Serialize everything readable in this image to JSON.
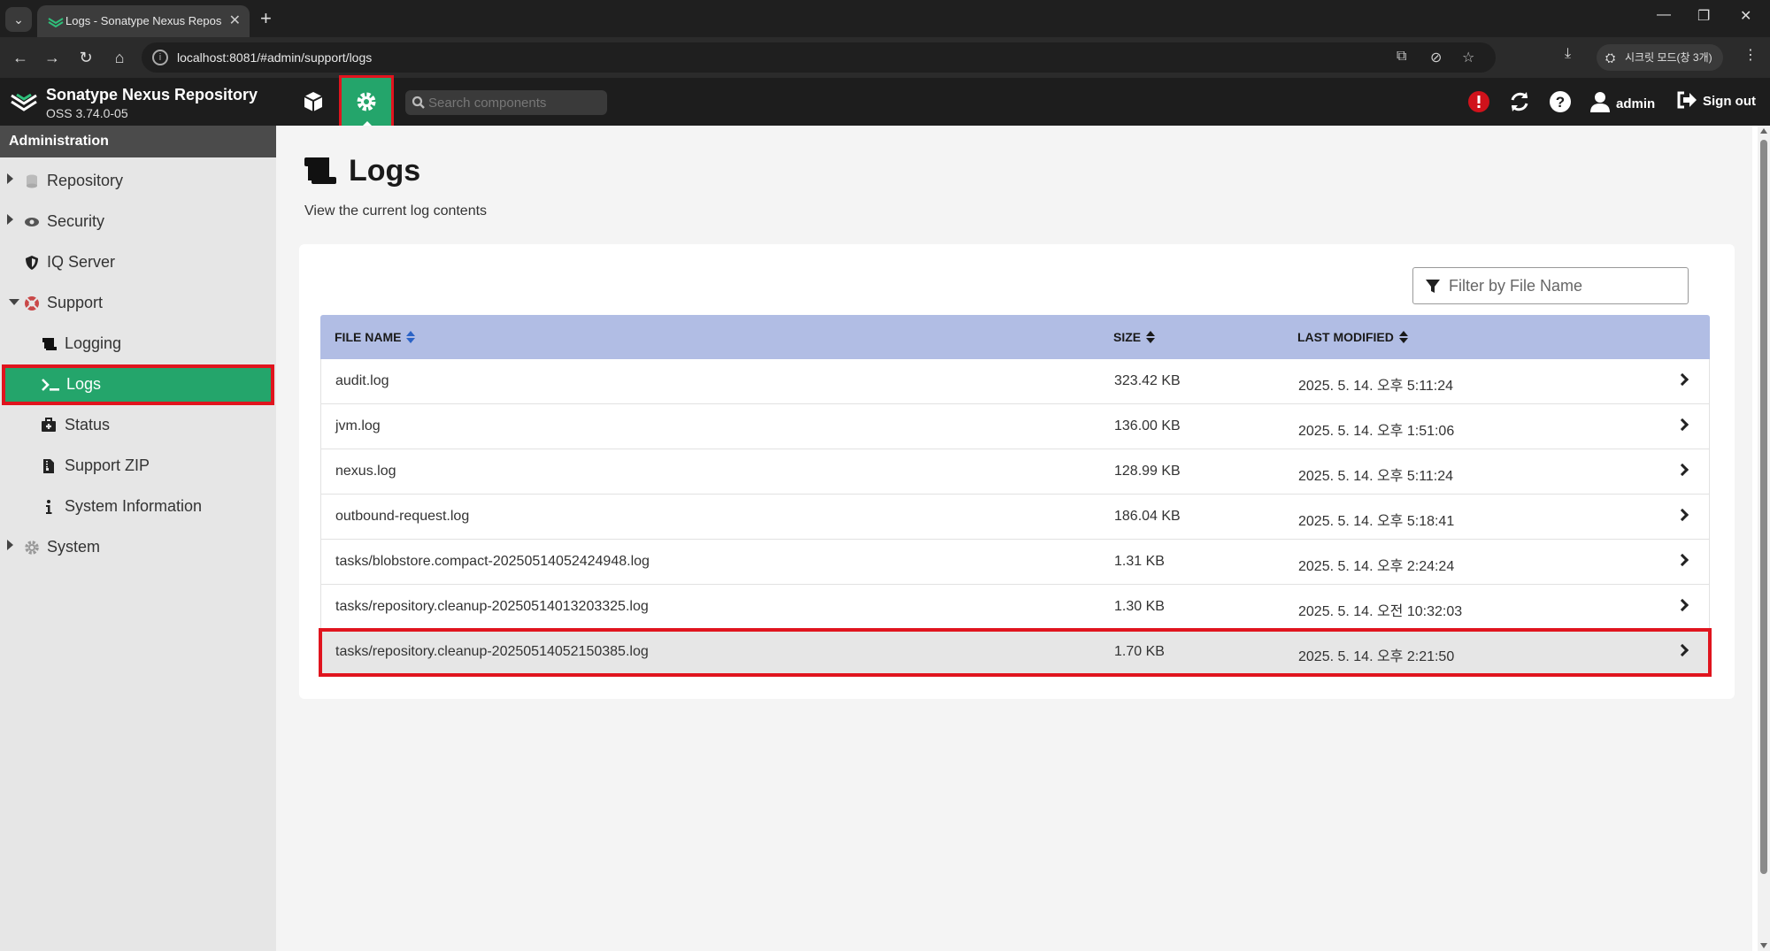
{
  "browser": {
    "tab_title": "Logs - Sonatype Nexus Repos",
    "url": "localhost:8081/#admin/support/logs",
    "incognito_label": "시크릿 모드(창 3개)"
  },
  "header": {
    "app_title": "Sonatype Nexus Repository",
    "version": "OSS 3.74.0-05",
    "search_placeholder": "Search components",
    "user": "admin",
    "signout": "Sign out",
    "accent_color": "#24a56b"
  },
  "sidebar": {
    "heading": "Administration",
    "items": [
      {
        "label": "Repository",
        "icon": "database-icon",
        "expandable": true,
        "expanded": false
      },
      {
        "label": "Security",
        "icon": "eye-icon",
        "expandable": true,
        "expanded": false
      },
      {
        "label": "IQ Server",
        "icon": "shield-icon",
        "expandable": false
      },
      {
        "label": "Support",
        "icon": "lifebuoy-icon",
        "expandable": true,
        "expanded": true
      },
      {
        "label": "Logging",
        "icon": "scroll-icon",
        "child": true
      },
      {
        "label": "Logs",
        "icon": "terminal-icon",
        "child": true,
        "active": true
      },
      {
        "label": "Status",
        "icon": "medkit-icon",
        "child": true
      },
      {
        "label": "Support ZIP",
        "icon": "file-zip-icon",
        "child": true
      },
      {
        "label": "System Information",
        "icon": "info-icon",
        "child": true
      },
      {
        "label": "System",
        "icon": "gear-icon",
        "expandable": true,
        "expanded": false
      }
    ]
  },
  "main": {
    "title": "Logs",
    "subtitle": "View the current log contents",
    "filter_placeholder": "Filter by File Name",
    "columns": [
      "FILE NAME",
      "SIZE",
      "LAST MODIFIED"
    ],
    "rows": [
      {
        "name": "audit.log",
        "size": "323.42 KB",
        "modified": "2025. 5. 14. 오후 5:11:24"
      },
      {
        "name": "jvm.log",
        "size": "136.00 KB",
        "modified": "2025. 5. 14. 오후 1:51:06"
      },
      {
        "name": "nexus.log",
        "size": "128.99 KB",
        "modified": "2025. 5. 14. 오후 5:11:24"
      },
      {
        "name": "outbound-request.log",
        "size": "186.04 KB",
        "modified": "2025. 5. 14. 오후 5:18:41"
      },
      {
        "name": "tasks/blobstore.compact-20250514052424948.log",
        "size": "1.31 KB",
        "modified": "2025. 5. 14. 오후 2:24:24"
      },
      {
        "name": "tasks/repository.cleanup-20250514013203325.log",
        "size": "1.30 KB",
        "modified": "2025. 5. 14. 오전 10:32:03"
      },
      {
        "name": "tasks/repository.cleanup-20250514052150385.log",
        "size": "1.70 KB",
        "modified": "2025. 5. 14. 오후 2:21:50",
        "selected": true
      }
    ]
  }
}
